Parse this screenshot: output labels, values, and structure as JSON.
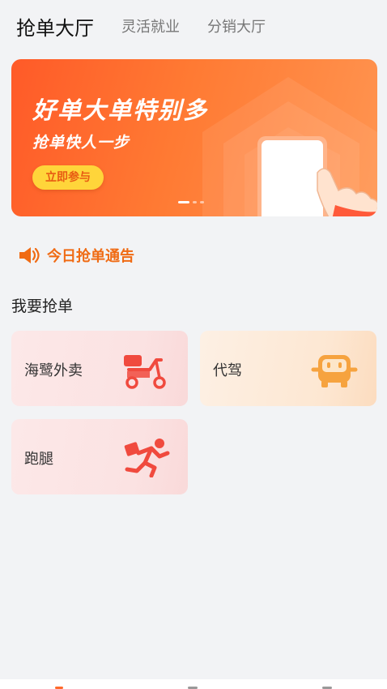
{
  "tabs": [
    {
      "label": "抢单大厅",
      "active": true
    },
    {
      "label": "灵活就业",
      "active": false
    },
    {
      "label": "分销大厅",
      "active": false
    }
  ],
  "banner": {
    "title": "好单大单特别多",
    "subtitle": "抢单快人一步",
    "button": "立即参与",
    "page_count": 3,
    "active_page": 1
  },
  "notice": {
    "icon": "speaker-icon",
    "text": "今日抢单通告"
  },
  "section": {
    "title": "我要抢单"
  },
  "services": [
    {
      "label": "海鹭外卖",
      "icon": "scooter-icon"
    },
    {
      "label": "代驾",
      "icon": "car-icon"
    },
    {
      "label": "跑腿",
      "icon": "running-man-icon"
    }
  ],
  "colors": {
    "accent": "#ff6a2b",
    "notice": "#f06b14",
    "button_yellow": "#ffd53a",
    "icon_red": "#f04a3e",
    "icon_orange": "#f6a33f"
  }
}
